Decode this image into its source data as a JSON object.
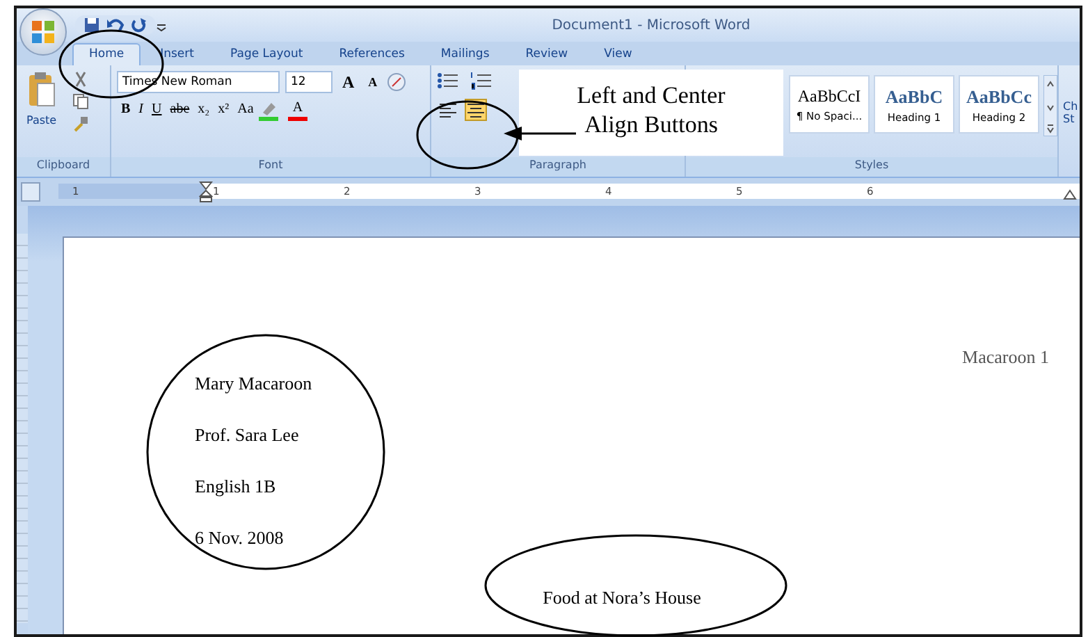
{
  "window": {
    "title": "Document1 - Microsoft Word"
  },
  "tabs": [
    {
      "label": "Home",
      "selected": true
    },
    {
      "label": "Insert",
      "selected": false
    },
    {
      "label": "Page Layout",
      "selected": false
    },
    {
      "label": "References",
      "selected": false
    },
    {
      "label": "Mailings",
      "selected": false
    },
    {
      "label": "Review",
      "selected": false
    },
    {
      "label": "View",
      "selected": false
    }
  ],
  "ribbon": {
    "clipboard": {
      "paste": "Paste",
      "label": "Clipboard"
    },
    "font": {
      "name": "Times New Roman",
      "size": "12",
      "size_buttons": [
        "A",
        "A"
      ],
      "format_buttons": [
        "B",
        "I",
        "U",
        "abe",
        "x₂",
        "x²",
        "Aa"
      ],
      "font_color": "A",
      "label": "Font"
    },
    "paragraph": {
      "align_buttons": [
        {
          "kind": "left",
          "selected": false
        },
        {
          "kind": "center",
          "selected": true
        }
      ],
      "label": "Paragraph"
    },
    "styles": {
      "gallery": [
        {
          "sample": "AaBbCcI",
          "name": "¶ No Spaci...",
          "kind": "plain"
        },
        {
          "sample": "AaBbC",
          "name": "Heading 1",
          "kind": "heading"
        },
        {
          "sample": "AaBbCc",
          "name": "Heading 2",
          "kind": "heading"
        }
      ],
      "label": "Styles",
      "change_styles": [
        "Ch",
        "St"
      ]
    }
  },
  "ruler": {
    "numbers": [
      "1",
      "1",
      "2",
      "3",
      "4",
      "5",
      "6"
    ]
  },
  "callout": {
    "lines": [
      "Left and Center",
      "Align Buttons"
    ]
  },
  "document": {
    "header": "Macaroon 1",
    "heading_lines": [
      "Mary Macaroon",
      "Prof. Sara Lee",
      "English 1B",
      "6 Nov. 2008"
    ],
    "title": "Food at Nora’s House"
  }
}
